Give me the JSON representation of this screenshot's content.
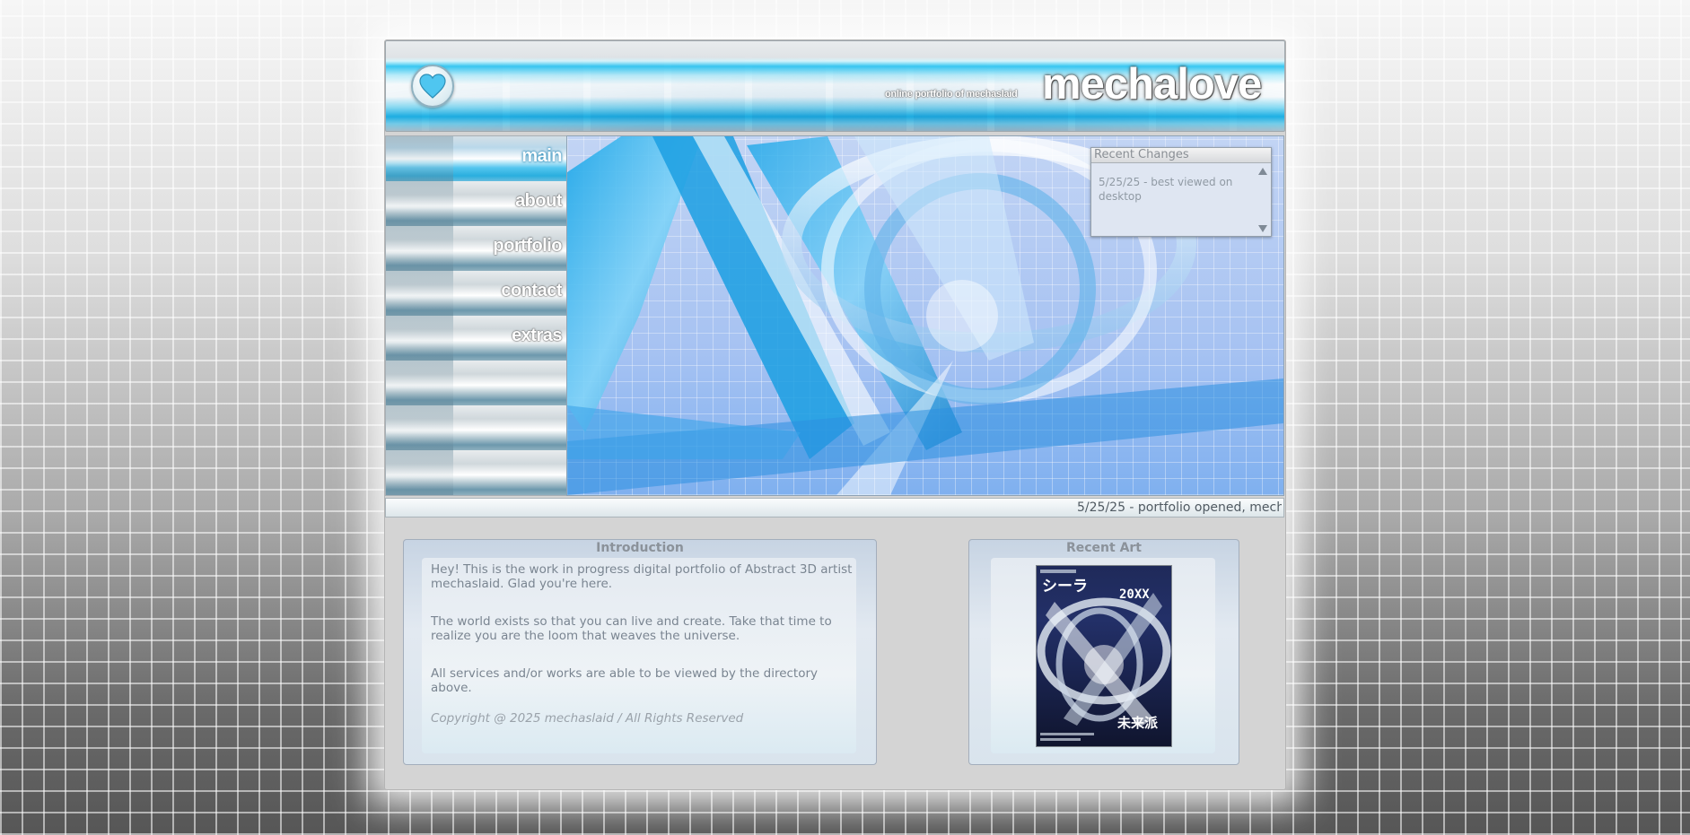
{
  "header": {
    "site_title": "mechalove",
    "tagline": "online portfolio of mechaslaid"
  },
  "nav": {
    "items": [
      {
        "label": "main",
        "active": true
      },
      {
        "label": "about",
        "active": false
      },
      {
        "label": "portfolio",
        "active": false
      },
      {
        "label": "contact",
        "active": false
      },
      {
        "label": "extras",
        "active": false
      },
      {
        "label": "",
        "active": false
      },
      {
        "label": "",
        "active": false
      },
      {
        "label": "",
        "active": false
      }
    ]
  },
  "recent_changes": {
    "title": "Recent Changes",
    "entry": "5/25/25 - best viewed on desktop"
  },
  "ticker": {
    "text": "5/25/25 - portfolio opened, mech"
  },
  "intro": {
    "title": "Introduction",
    "p1": "Hey! This is the work in progress digital portfolio of Abstract 3D artist mechaslaid. Glad you're here.",
    "p2": "The world exists so that you can live and create. Take that time to realize you are the loom that weaves the universe.",
    "p3": "All services and/or works are able to be viewed by the directory above.",
    "copyright": "Copyright @ 2025 mechaslaid / All Rights Reserved"
  },
  "recent_art": {
    "title": "Recent Art",
    "art_text_top": "シーラ",
    "art_text_year": "20XX",
    "art_text_bottom": "未来派"
  },
  "colors": {
    "accent_cyan": "#2aaede",
    "heart": "#4fc6f0",
    "page_bg_top": "#f6f6f6",
    "page_bg_bottom": "#565656"
  }
}
